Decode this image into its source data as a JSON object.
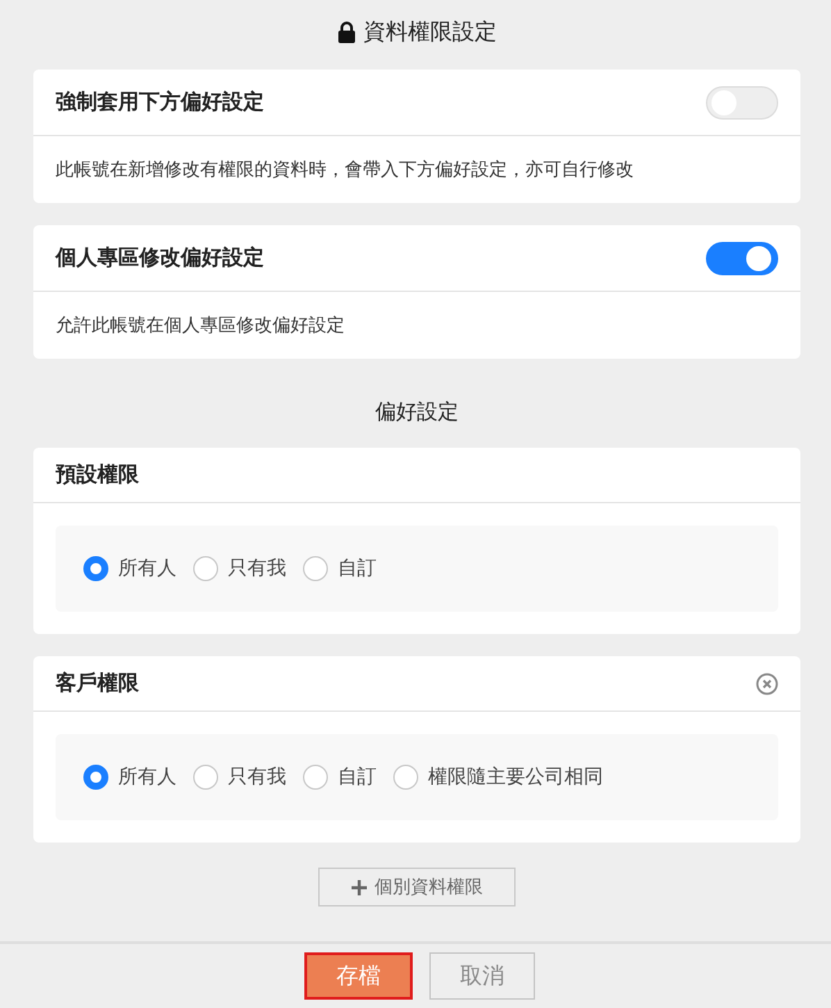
{
  "header": {
    "title": "資料權限設定"
  },
  "settings": [
    {
      "title": "強制套用下方偏好設定",
      "on": false,
      "description": "此帳號在新增修改有權限的資料時，會帶入下方偏好設定，亦可自行修改"
    },
    {
      "title": "個人專區修改偏好設定",
      "on": true,
      "description": "允許此帳號在個人專區修改偏好設定"
    }
  ],
  "preferences": {
    "title": "偏好設定",
    "groups": [
      {
        "title": "預設權限",
        "removable": false,
        "options": [
          {
            "label": "所有人",
            "selected": true
          },
          {
            "label": "只有我",
            "selected": false
          },
          {
            "label": "自訂",
            "selected": false
          }
        ]
      },
      {
        "title": "客戶權限",
        "removable": true,
        "options": [
          {
            "label": "所有人",
            "selected": true
          },
          {
            "label": "只有我",
            "selected": false
          },
          {
            "label": "自訂",
            "selected": false
          },
          {
            "label": "權限隨主要公司相同",
            "selected": false
          }
        ]
      }
    ]
  },
  "add_button": {
    "label": "個別資料權限"
  },
  "footer": {
    "buttons": [
      {
        "label": "存檔",
        "kind": "primary",
        "focused": true
      },
      {
        "label": "取消",
        "kind": "secondary",
        "focused": false
      }
    ]
  }
}
